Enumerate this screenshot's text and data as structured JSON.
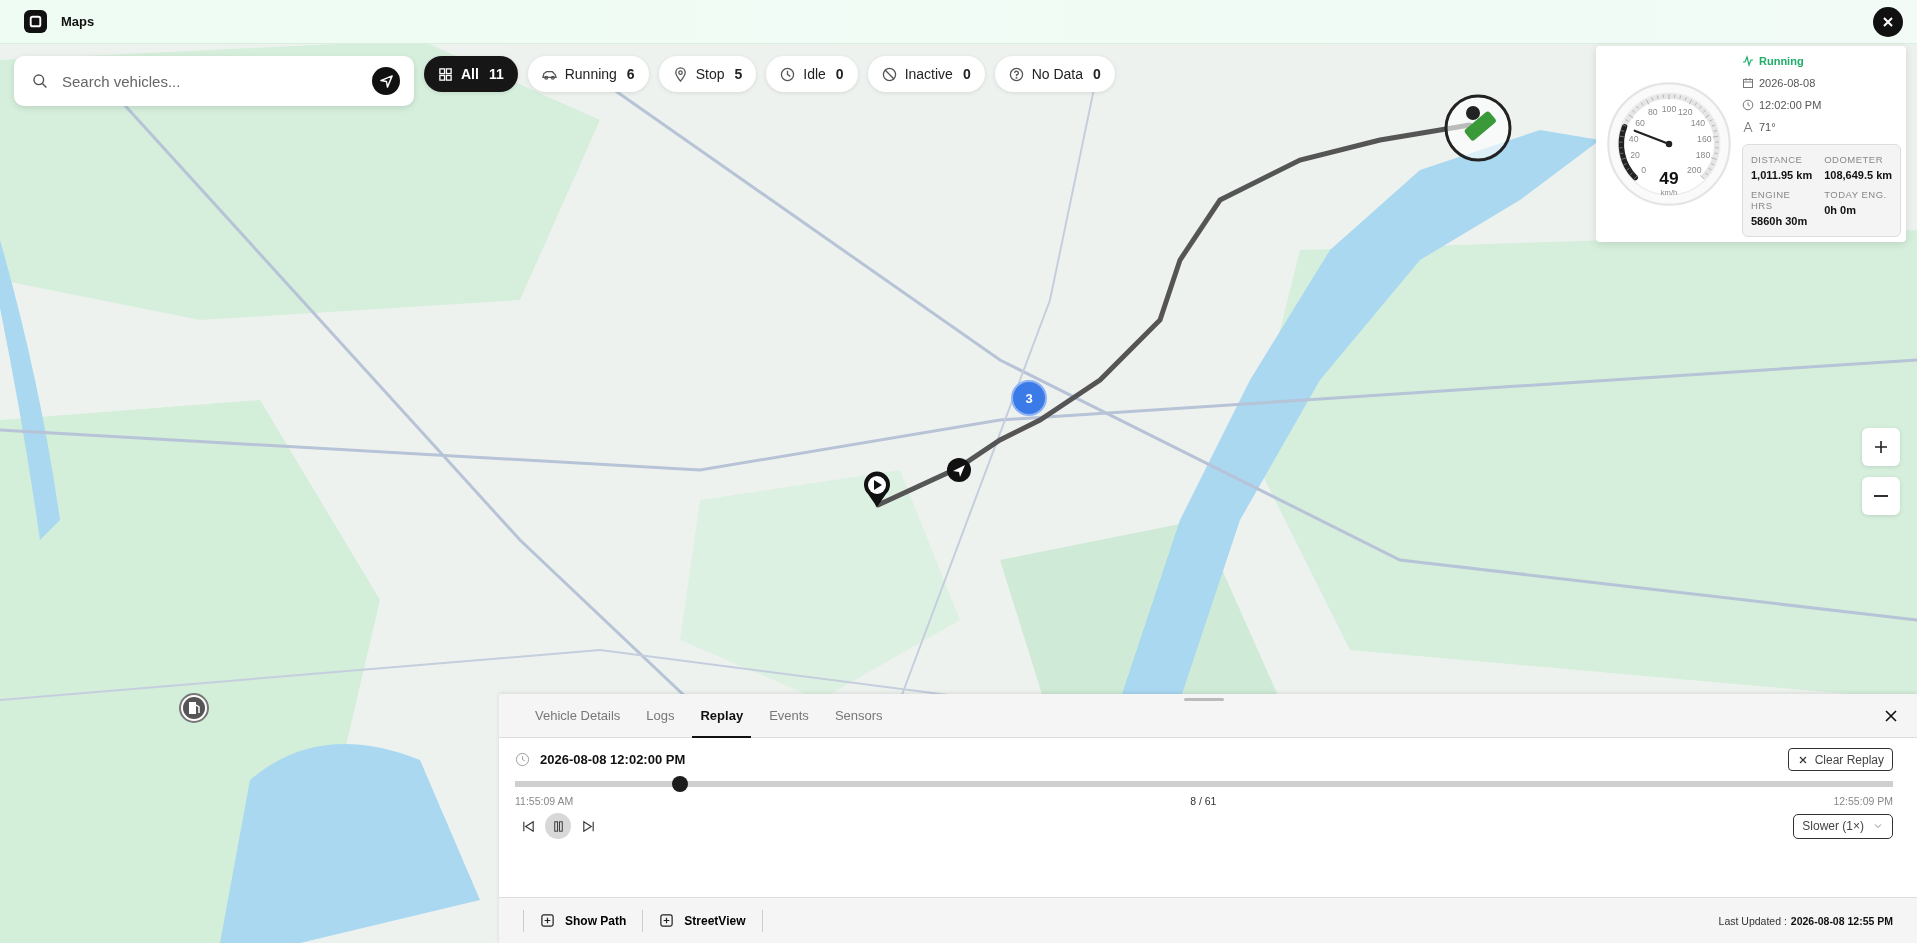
{
  "app": {
    "title": "Maps"
  },
  "search": {
    "placeholder": "Search vehicles..."
  },
  "filters": [
    {
      "label": "All",
      "count": "11",
      "kind": "all",
      "selected": true
    },
    {
      "label": "Running",
      "count": "6",
      "kind": "running",
      "selected": false
    },
    {
      "label": "Stop",
      "count": "5",
      "kind": "stop",
      "selected": false
    },
    {
      "label": "Idle",
      "count": "0",
      "kind": "idle",
      "selected": false
    },
    {
      "label": "Inactive",
      "count": "0",
      "kind": "inactive",
      "selected": false
    },
    {
      "label": "No Data",
      "count": "0",
      "kind": "nodata",
      "selected": false
    }
  ],
  "map": {
    "kind": "picture",
    "cluster_count": "3"
  },
  "vehicle_card": {
    "status": "Running",
    "date": "2026-08-08",
    "time": "12:02:00 PM",
    "heading": "71°",
    "speed": "49",
    "speed_unit": "km/h",
    "level": 0.245,
    "gauge_ticks": [
      "0",
      "20",
      "40",
      "60",
      "80",
      "100",
      "120",
      "140",
      "160",
      "180",
      "200"
    ],
    "stats": [
      {
        "label": "DISTANCE",
        "value": "1,011.95 km"
      },
      {
        "label": "ODOMETER",
        "value": "108,649.5 km"
      },
      {
        "label": "ENGINE HRS",
        "value": "5860h 30m"
      },
      {
        "label": "TODAY ENG.",
        "value": "0h 0m"
      }
    ]
  },
  "panel": {
    "tabs": [
      {
        "label": "Vehicle Details",
        "selected": false
      },
      {
        "label": "Logs",
        "selected": false
      },
      {
        "label": "Replay",
        "selected": true
      },
      {
        "label": "Events",
        "selected": false
      },
      {
        "label": "Sensors",
        "selected": false
      }
    ],
    "timestamp": "2026-08-08 12:02:00 PM",
    "clear_button": "Clear Replay",
    "progress": {
      "level": 0.12,
      "start": "11:55:09 AM",
      "position": "8 / 61",
      "end": "12:55:09 PM"
    },
    "playing": true,
    "speed": "Slower (1×)",
    "footer_buttons": [
      "Show Path",
      "StreetView"
    ],
    "last_updated_label": "Last Updated :",
    "last_updated": "2026-08-08 12:55 PM"
  }
}
